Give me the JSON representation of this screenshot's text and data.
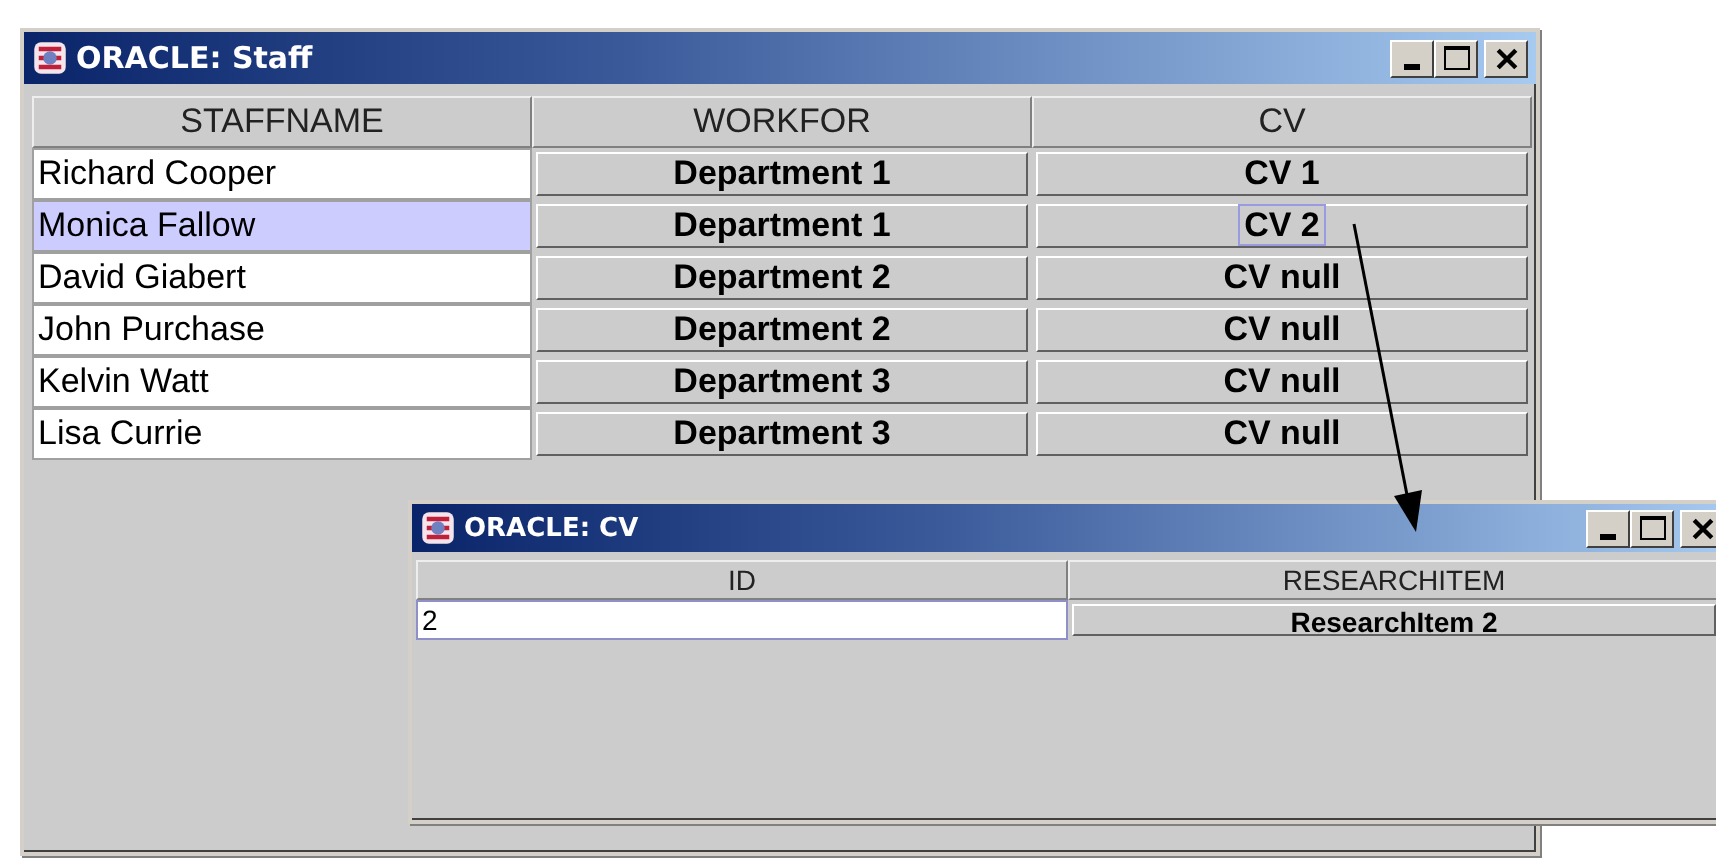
{
  "staff_window": {
    "title": "ORACLE: Staff",
    "columns": [
      "STAFFNAME",
      "WORKFOR",
      "CV"
    ],
    "rows": [
      {
        "staffname": "Richard Cooper",
        "workfor": "Department 1",
        "cv": "CV 1",
        "selected": false
      },
      {
        "staffname": "Monica Fallow",
        "workfor": "Department 1",
        "cv": "CV 2",
        "selected": true
      },
      {
        "staffname": "David Giabert",
        "workfor": "Department 2",
        "cv": "CV null",
        "selected": false
      },
      {
        "staffname": "John Purchase",
        "workfor": "Department 2",
        "cv": "CV null",
        "selected": false
      },
      {
        "staffname": "Kelvin Watt",
        "workfor": "Department 3",
        "cv": "CV null",
        "selected": false
      },
      {
        "staffname": "Lisa Currie",
        "workfor": "Department 3",
        "cv": "CV null",
        "selected": false
      }
    ]
  },
  "cv_window": {
    "title": "ORACLE: CV",
    "columns": [
      "ID",
      "RESEARCHITEM"
    ],
    "rows": [
      {
        "id": "2",
        "researchitem": "ResearchItem 2",
        "focused": true
      }
    ]
  }
}
